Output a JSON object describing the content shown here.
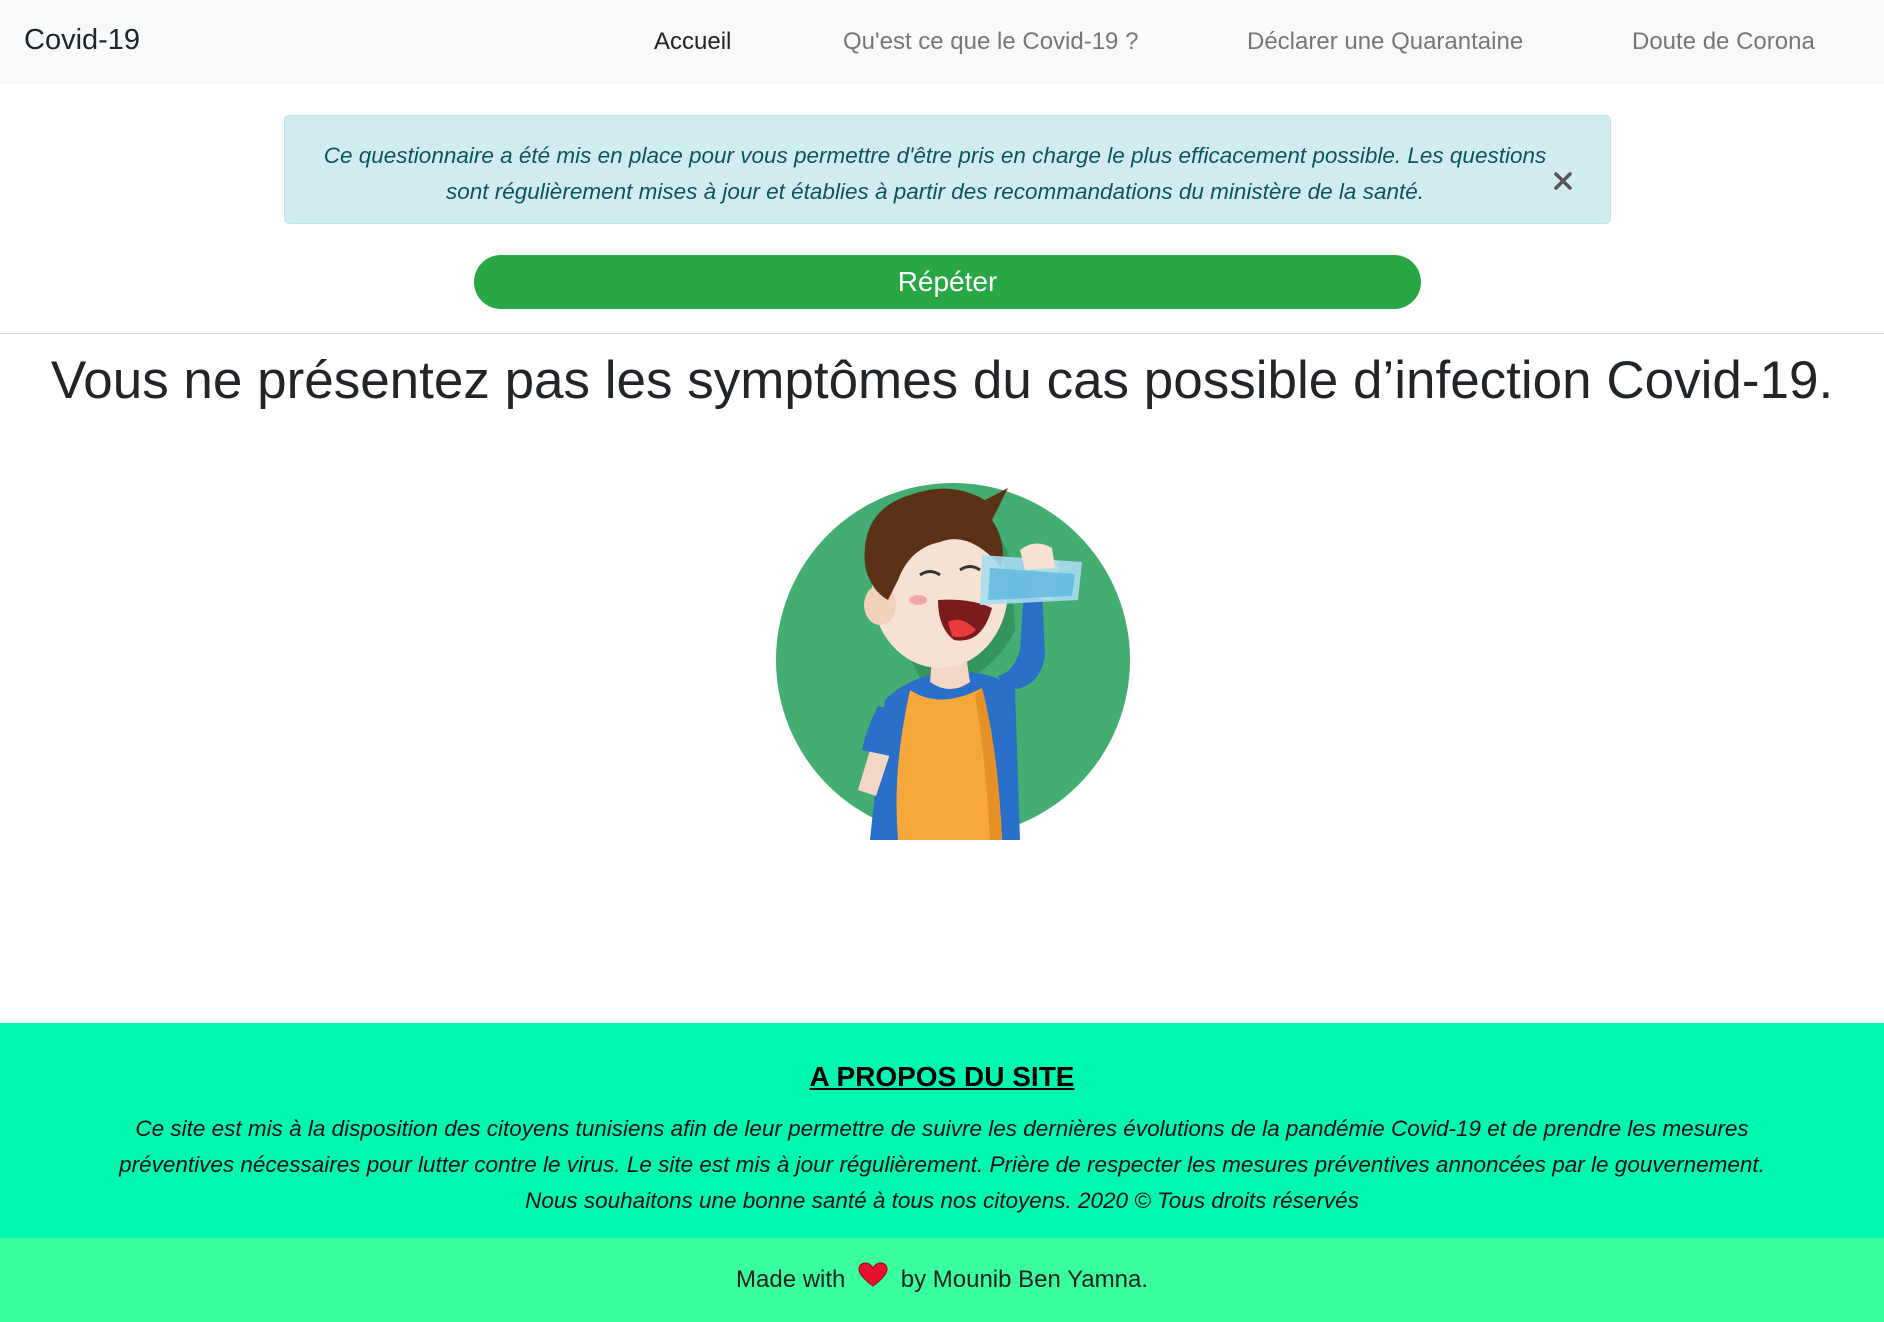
{
  "navbar": {
    "brand": "Covid-19",
    "links": [
      {
        "label": "Accueil"
      },
      {
        "label": "Qu'est ce que le Covid-19 ?"
      },
      {
        "label": "Déclarer une Quarantaine"
      },
      {
        "label": "Doute de Corona"
      }
    ]
  },
  "alert": {
    "text": "Ce questionnaire a été mis en place pour vous permettre d'être pris en charge le plus efficacement possible. Les questions sont régulièrement mises à jour et établies à partir des recommandations du ministère de la santé.",
    "close_icon": "close-icon"
  },
  "actions": {
    "repeat_label": "Répéter"
  },
  "result": {
    "headline": "Vous ne présentez pas les symptômes du cas possible d’infection Covid-19.",
    "illustration": "boy-drinking-water-illustration"
  },
  "footer": {
    "about_title": "A PROPOS DU SITE",
    "about_text": "Ce site est mis à la disposition des citoyens tunisiens afin de leur permettre de suivre les dernières évolutions de la pandémie Covid-19 et de prendre les mesures préventives nécessaires pour lutter contre le virus. Le site est mis à jour régulièrement. Prière de respecter les mesures préventives annoncées par le gouvernement. Nous souhaitons une bonne santé à tous nos citoyens. 2020 © Tous droits réservés",
    "credit_prefix": "Made with",
    "credit_suffix": "by Mounib Ben Yamna.",
    "heart_icon": "heart-icon"
  },
  "colors": {
    "navbar_bg": "#f8f9fa",
    "alert_bg": "#d1ecf1",
    "button_green": "#28a745",
    "about_bg": "#00f7b0",
    "credit_bg": "#3aff9e"
  }
}
